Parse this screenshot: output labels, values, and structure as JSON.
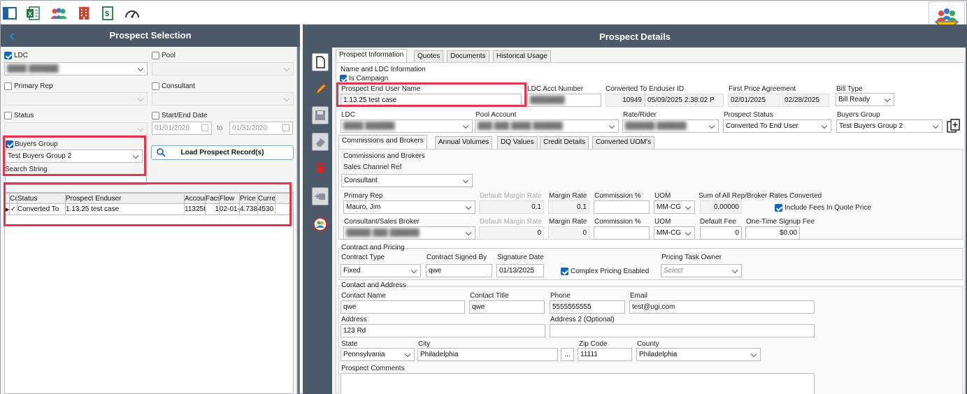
{
  "toolbar": {
    "icons": [
      "layout-icon",
      "excel-icon",
      "users-icon",
      "building-icon",
      "dollar-doc-icon",
      "gauge-icon"
    ]
  },
  "left": {
    "title": "Prospect Selection",
    "ldc_label": "LDC",
    "pool_label": "Pool",
    "primary_rep_label": "Primary Rep",
    "consultant_label": "Consultant",
    "status_label": "Status",
    "start_end_label": "Start/End Date",
    "start_date": "01/01/2020",
    "to_label": "to",
    "end_date": "01/31/2020",
    "buyers_group_label": "Buyers Group",
    "buyers_group_value": "Test Buyers Group 2",
    "search_string_label": "Search String",
    "load_button": "Load Prospect Record(s)",
    "grid": {
      "headers": [
        "Co",
        "Status",
        "Prospect Enduser",
        "Accoun",
        "Facs",
        "Flow",
        "Price",
        "Curre"
      ],
      "rows": [
        [
          "✓",
          "Converted To",
          "1.13.25 test case",
          "11325te",
          "1",
          "02-01-",
          "4.738",
          "4530"
        ]
      ]
    }
  },
  "right": {
    "title": "Prospect Details",
    "tabs": [
      "Prospect Information",
      "Quotes",
      "Documents",
      "Historical Usage"
    ],
    "name_ldc_group": "Name and LDC Information",
    "is_campaign": "Is Campaign",
    "prospect_end_user_label": "Prospect End User Name",
    "prospect_end_user_value": "1.13.25 test case",
    "ldc_acct_label": "LDC Acct Number",
    "converted_label": "Converted To Enduser ID",
    "converted_id": "10949",
    "converted_date": "05/09/2025 2:38:02 P",
    "first_price_label": "First Price Agreement",
    "first_price_from": "02/01/2025",
    "first_price_to": "02/28/2025",
    "bill_type_label": "Bill Type",
    "bill_type_value": "Bill Ready",
    "ldc_label": "LDC",
    "pool_account_label": "Pool Account",
    "rate_rider_label": "Rate/Rider",
    "prospect_status_label": "Prospect Status",
    "prospect_status_value": "Converted To End User",
    "buyers_group_label": "Buyers Group",
    "buyers_group_value": "Test Buyers Group 2",
    "subtabs": [
      "Commissions and Brokers",
      "Annual Volumes",
      "DQ Values",
      "Credit Details",
      "Converted UOM's"
    ],
    "comm_group": "Commissions and Brokers",
    "sales_channel_label": "Sales Channel Ref",
    "sales_channel_value": "Consultant",
    "primary_rep_label": "Primary Rep",
    "primary_rep_value": "Mauro, Jim",
    "default_margin_label": "Default Margin Rate",
    "margin_rate_label": "Margin Rate",
    "commission_label": "Commission %",
    "uom_label": "UOM",
    "sum_rates_label": "Sum of All Rep/Broker Rates Converted",
    "default_margin_1": "0.1",
    "margin_rate_1": "0.1",
    "uom_1": "MM-CG",
    "sum_rates_value": "0.00000",
    "include_fees": "Include Fees In Quote Price",
    "consultant_broker_label": "Consultant/Sales Broker",
    "default_margin_2": "0",
    "margin_rate_2": "0",
    "uom_2": "MM-CG",
    "default_fee_label": "Default Fee",
    "default_fee_value": "0",
    "signup_fee_label": "One-Time Signup Fee",
    "signup_fee_value": "$0.00",
    "contract_group": "Contract and Pricing",
    "contract_type_label": "Contract Type",
    "contract_type_value": "Fixed",
    "contract_signed_label": "Contract Signed By",
    "contract_signed_value": "qwe",
    "signature_date_label": "Signature Date",
    "signature_date_value": "01/13/2025",
    "complex_pricing": "Complex Pricing Enabled",
    "pricing_owner_label": "Pricing Task Owner",
    "pricing_owner_value": "Select",
    "contact_group": "Contact and Address",
    "contact_name_label": "Contact Name",
    "contact_name_value": "qwe",
    "contact_title_label": "Contact Title",
    "contact_title_value": "qwe",
    "phone_label": "Phone",
    "phone_value": "5555555555",
    "email_label": "Email",
    "email_value": "test@ugi.com",
    "address_label": "Address",
    "address_value": "123 Rd",
    "address2_label": "Address 2 (Optional)",
    "state_label": "State",
    "state_value": "Pennsylvania",
    "city_label": "City",
    "city_value": "Philadelphia",
    "ellipsis": "...",
    "zip_label": "Zip Code",
    "zip_value": "11111",
    "county_label": "County",
    "county_value": "Philadelphia",
    "comments_label": "Prospect Comments"
  },
  "colors": {
    "header": "#4b5968",
    "highlight": "#e8344a",
    "accent": "#1565c0"
  }
}
